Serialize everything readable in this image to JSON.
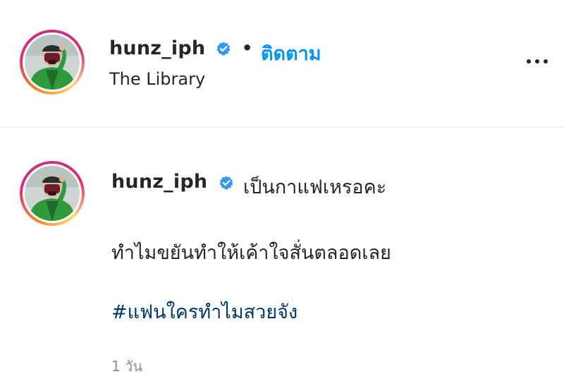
{
  "post_header": {
    "username": "hunz_iph",
    "separator": "•",
    "follow_label": "ติดตาม",
    "location": "The Library",
    "more_icon": "more-horizontal-icon",
    "verified_icon": "verified-badge-icon"
  },
  "caption": {
    "username": "hunz_iph",
    "line1": "เป็นกาแฟเหรอคะ",
    "line2": "ทำไมขยันทำให้เค้าใจสั่นตลอดเลย",
    "hashtag": "#แฟนใครทำไมสวยจัง",
    "timestamp": "1 วัน"
  },
  "colors": {
    "follow_blue": "#0095f6",
    "verified_blue": "#3897f0",
    "hashtag_blue": "#00376b",
    "secondary_text": "#8e8e8e",
    "primary_text": "#262626"
  }
}
